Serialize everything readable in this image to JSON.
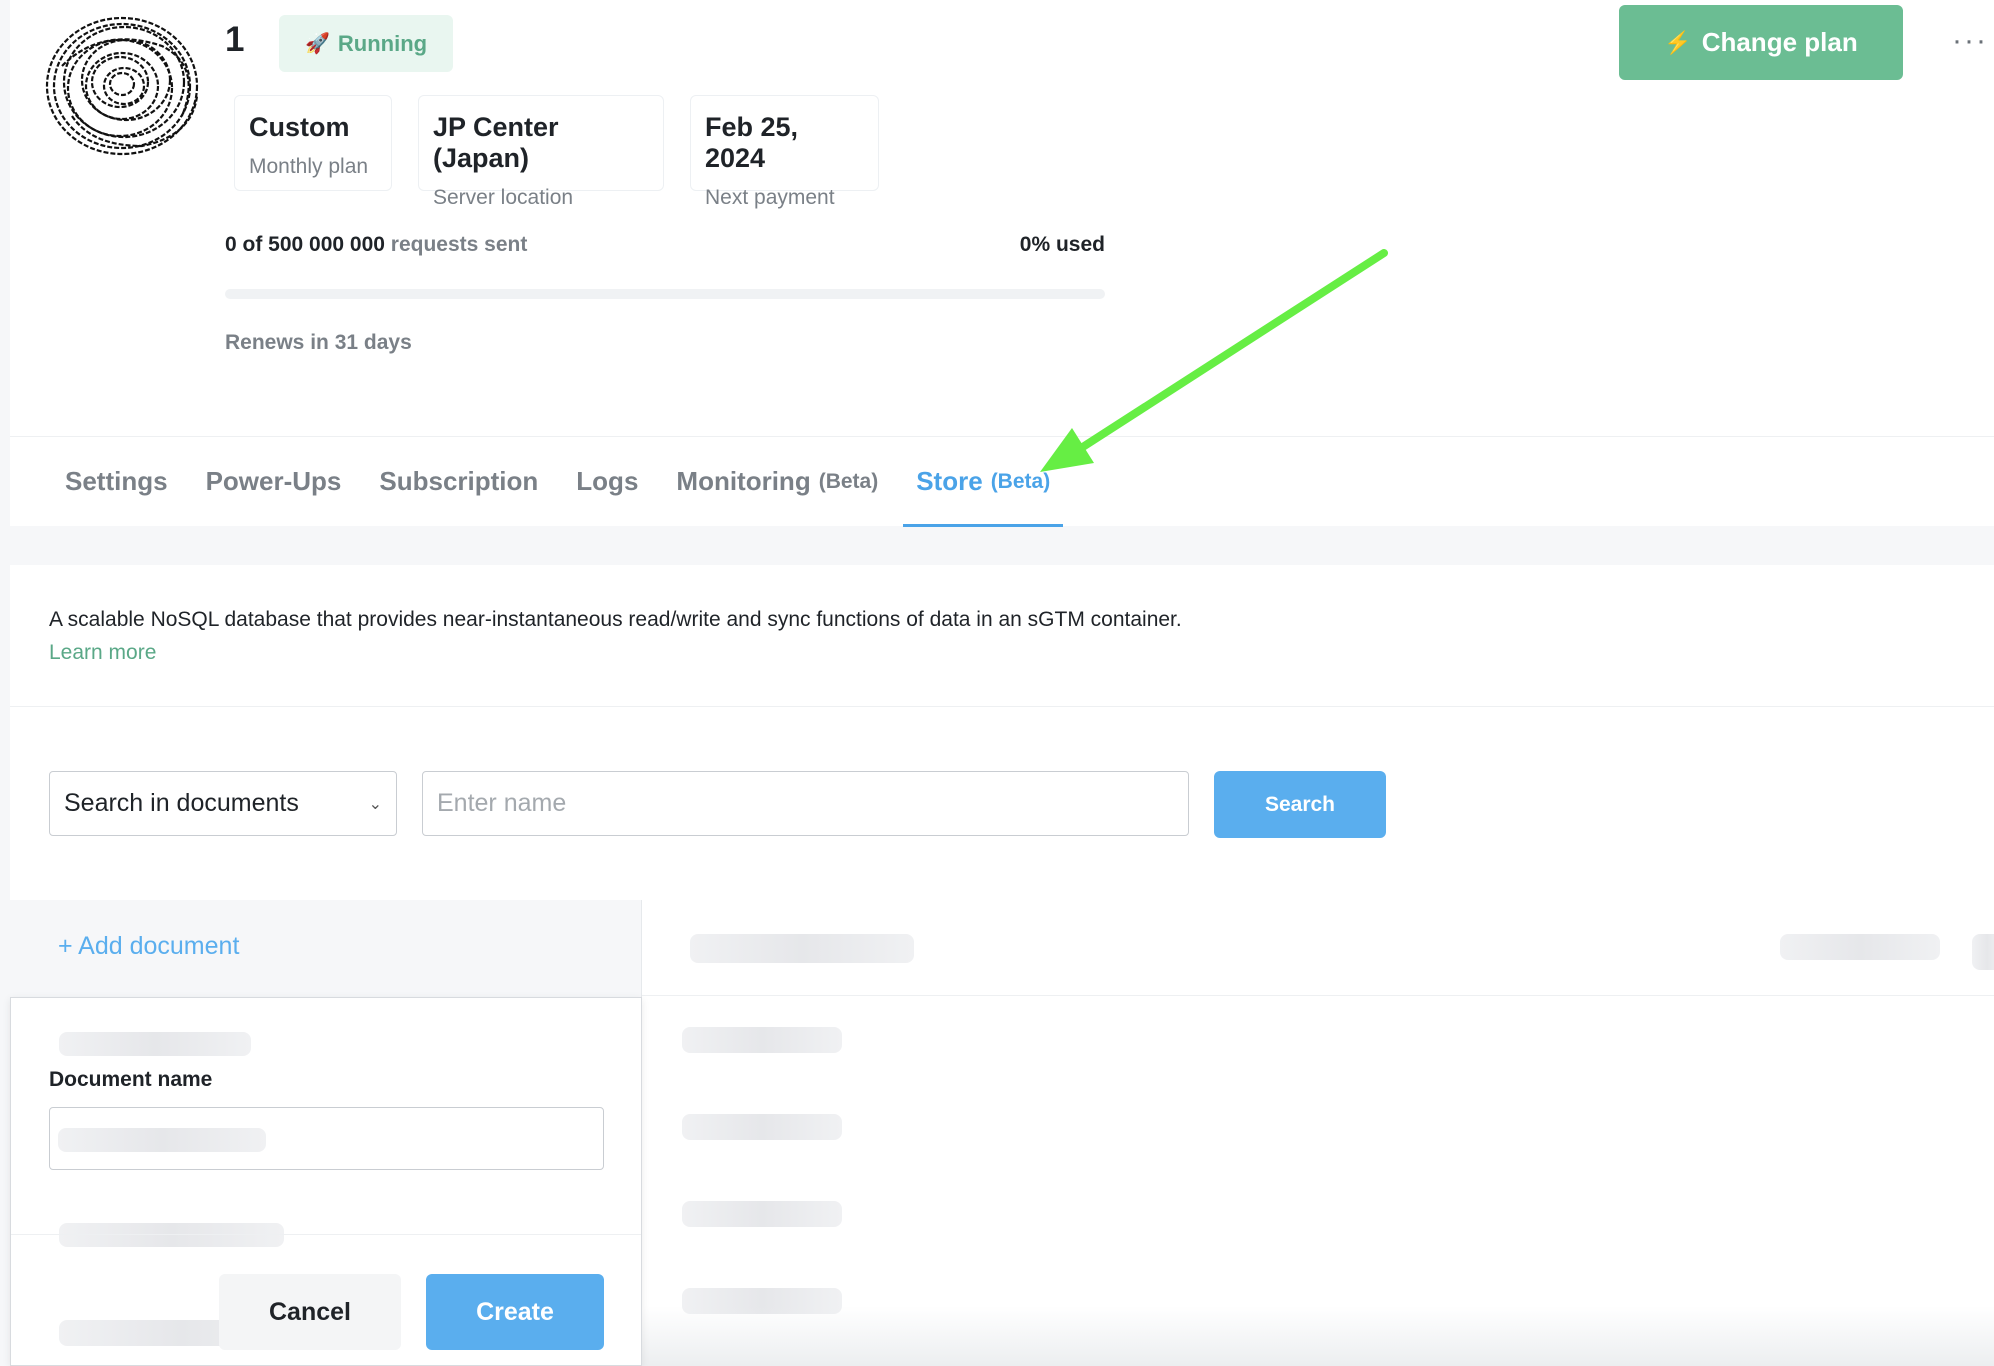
{
  "header": {
    "container_name": "1",
    "status": "Running",
    "status_icon": "rocket-icon",
    "change_plan_label": "Change plan",
    "change_plan_icon": "lightning-icon",
    "more_label": "···",
    "info_boxes": [
      {
        "value": "Custom",
        "label": "Monthly plan"
      },
      {
        "value": "JP Center (Japan)",
        "label": "Server location"
      },
      {
        "value": "Feb 25, 2024",
        "label": "Next payment"
      }
    ],
    "usage": {
      "count_text": "0 of 500 000 000",
      "suffix": "requests sent",
      "percent_text": "0% used",
      "percent_value": 0
    },
    "renews": "Renews in 31 days"
  },
  "tabs": [
    {
      "label": "Settings",
      "beta": ""
    },
    {
      "label": "Power-Ups",
      "beta": ""
    },
    {
      "label": "Subscription",
      "beta": ""
    },
    {
      "label": "Logs",
      "beta": ""
    },
    {
      "label": "Monitoring",
      "beta": "(Beta)"
    },
    {
      "label": "Store",
      "beta": "(Beta)",
      "active": true
    }
  ],
  "store": {
    "description": "A scalable NoSQL database that provides near-instantaneous read/write and sync functions of data in an sGTM container.",
    "learn_more": "Learn more",
    "search_scope": "Search in documents",
    "search_placeholder": "Enter name",
    "search_button": "Search",
    "add_document": "+ Add document"
  },
  "modal": {
    "document_name_label": "Document name",
    "cancel": "Cancel",
    "create": "Create"
  },
  "colors": {
    "accent_green": "#6bbd93",
    "accent_blue": "#5aaeee",
    "annotation_arrow": "#66ee44"
  }
}
